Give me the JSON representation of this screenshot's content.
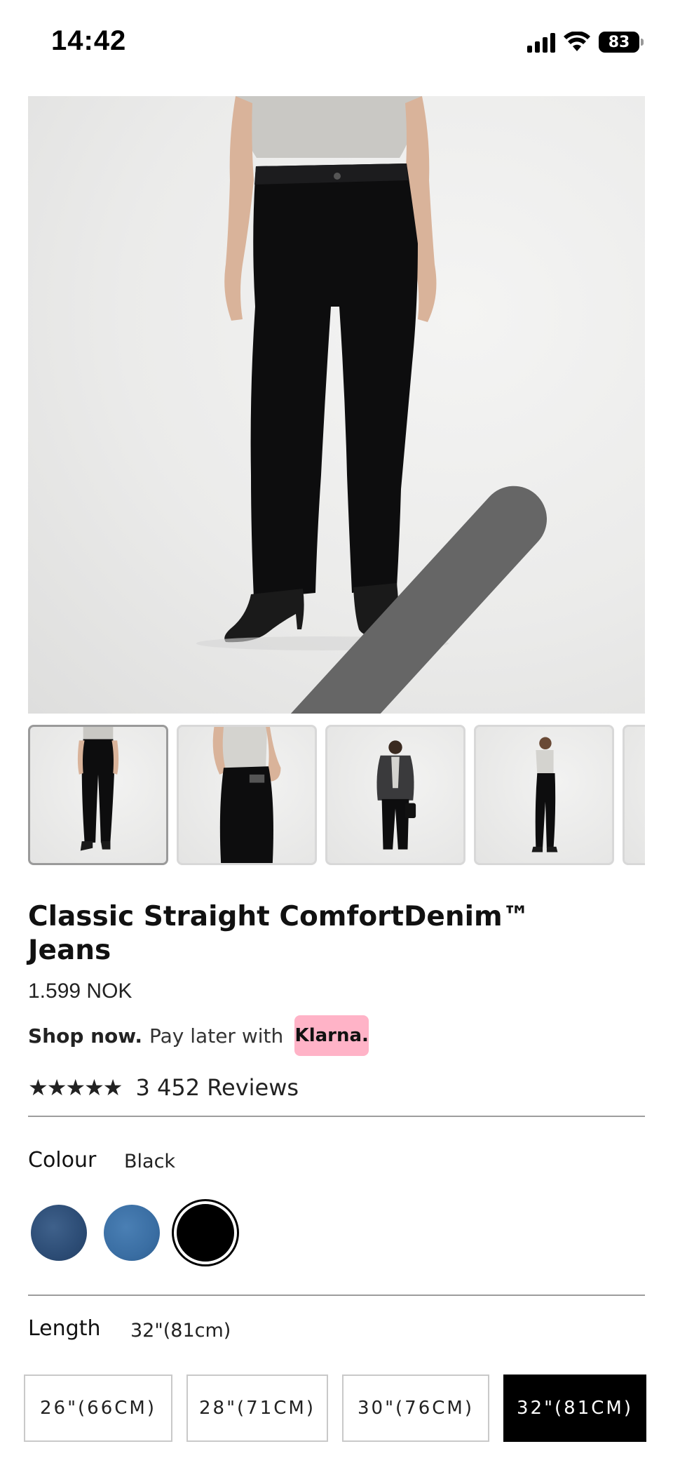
{
  "status_bar": {
    "time": "14:42",
    "battery": "83"
  },
  "gallery": {
    "prev_icon": "chevron-left-icon",
    "next_icon": "chevron-right-icon",
    "thumbnails": [
      "front-view",
      "back-view",
      "outfit-view",
      "side-view",
      "more"
    ]
  },
  "product": {
    "title": "Classic Straight ComfortDenim™ Jeans",
    "price": "1.599 NOK",
    "klarna": {
      "bold": "Shop now.",
      "text": "Pay later with",
      "badge": "Klarna.",
      "badge_color": "#ffb3c7"
    },
    "rating_stars": "★★★★★",
    "reviews": "3 452 Reviews"
  },
  "colour": {
    "label": "Colour",
    "value": "Black",
    "swatches": [
      "dark-denim",
      "mid-denim",
      "black"
    ],
    "selected": "black"
  },
  "length": {
    "label": "Length",
    "value": "32\"(81cm)",
    "options": [
      "26\"(66CM)",
      "28\"(71CM)",
      "30\"(76CM)",
      "32\"(81CM)"
    ],
    "selected_index": 3
  }
}
